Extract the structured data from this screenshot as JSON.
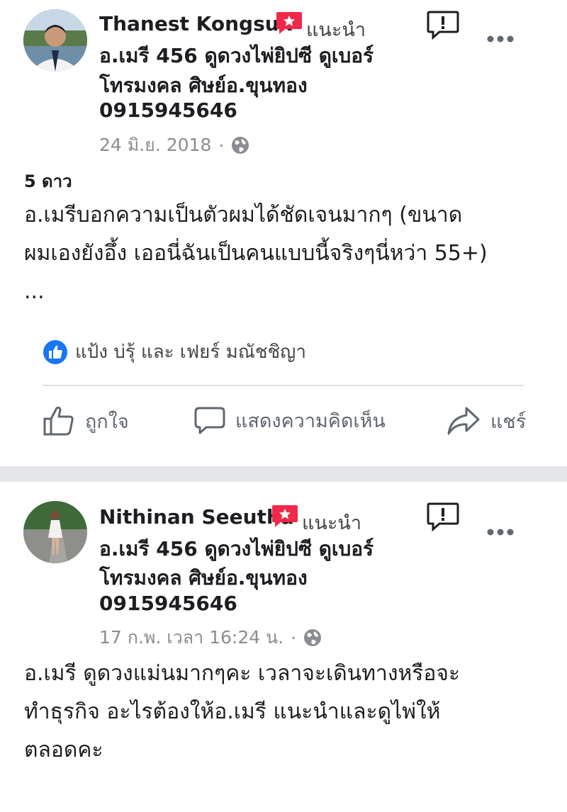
{
  "posts": [
    {
      "author": "Thanest Kongsuk",
      "recommends_label": "แนะนำ",
      "page_lines": [
        "อ.เมรี 456 ดูดวงไพ่ยิปซี ดูเบอร์",
        "โทรมงคล ศิษย์อ.ขุนทอง",
        "0915945646"
      ],
      "timestamp": "24 มิ.ย. 2018",
      "separator": "·",
      "rating": "5 ดาว",
      "text_lines": [
        "อ.เมรีบอกความเป็นตัวผมได้ชัดเจนมากๆ (ขนาด",
        "ผมเองยังอึ้ง เออนี่ฉันเป็นคนแบบนี้จริงๆนี่หว่า 55+)",
        "..."
      ],
      "likers": "แป้ง บ่รุ้ และ เฟยร์ มณัชชิญา",
      "actions": {
        "like": "ถูกใจ",
        "comment": "แสดงความคิดเห็น",
        "share": "แชร์"
      }
    },
    {
      "author": "Nithinan Seeutha",
      "recommends_label": "แนะนำ",
      "page_lines": [
        "อ.เมรี 456 ดูดวงไพ่ยิปซี ดูเบอร์",
        "โทรมงคล ศิษย์อ.ขุนทอง",
        "0915945646"
      ],
      "timestamp": "17 ก.พ. เวลา 16:24 น.",
      "separator": "·",
      "text_lines": [
        "อ.เมรี ดูดวงแม่นมากๆคะ เวลาจะเดินทางหรือจะ",
        "ทำธุรกิจ อะไรต้องให้อ.เมรี แนะนำและดูไพ่ให้",
        "ตลอดคะ"
      ]
    }
  ],
  "icons": {
    "recommend": "recommend-badge-icon",
    "report": "report-icon",
    "more": "more-options-icon",
    "globe": "public-globe-icon",
    "like": "like-thumb-icon",
    "comment": "comment-bubble-icon",
    "share": "share-arrow-icon"
  },
  "colors": {
    "recommend": "#f02849",
    "like_blue": "#1877f2",
    "separator": "#e6e7ea",
    "muted": "#8a8d91"
  }
}
